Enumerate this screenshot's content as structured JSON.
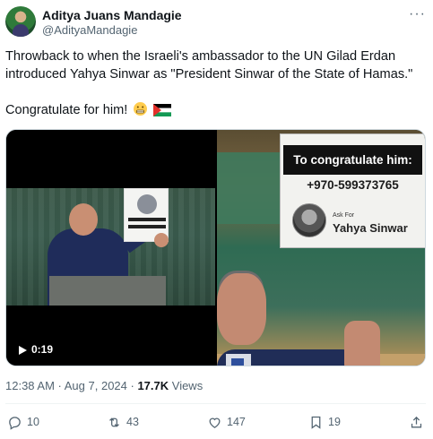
{
  "author": {
    "name": "Aditya Juans Mandagie",
    "handle": "@AdityaMandagie",
    "more_icon": "ellipsis-icon"
  },
  "tweet": {
    "line1": "Throwback to when the Israeli's ambassador to the UN Gilad Erdan introduced Yahya Sinwar as \"President Sinwar of the State of Hamas.\"",
    "line2": "Congratulate for him!",
    "emojis": [
      "grimace-face-emoji",
      "palestine-flag-emoji"
    ]
  },
  "media": {
    "duration": "0:19",
    "sign": {
      "banner": "To congratulate him:",
      "phone": "+970-599373765",
      "ask_for": "Ask For",
      "name": "Yahya Sinwar"
    }
  },
  "meta": {
    "timestamp": "12:38 AM · Aug 7, 2024 · ",
    "views_count": "17.7K",
    "views_label": " Views"
  },
  "actions": {
    "replies": "10",
    "reposts": "43",
    "likes": "147",
    "bookmarks": "19"
  },
  "colors": {
    "text": "#0f1419",
    "secondary": "#536471",
    "border": "#cfd9de"
  }
}
